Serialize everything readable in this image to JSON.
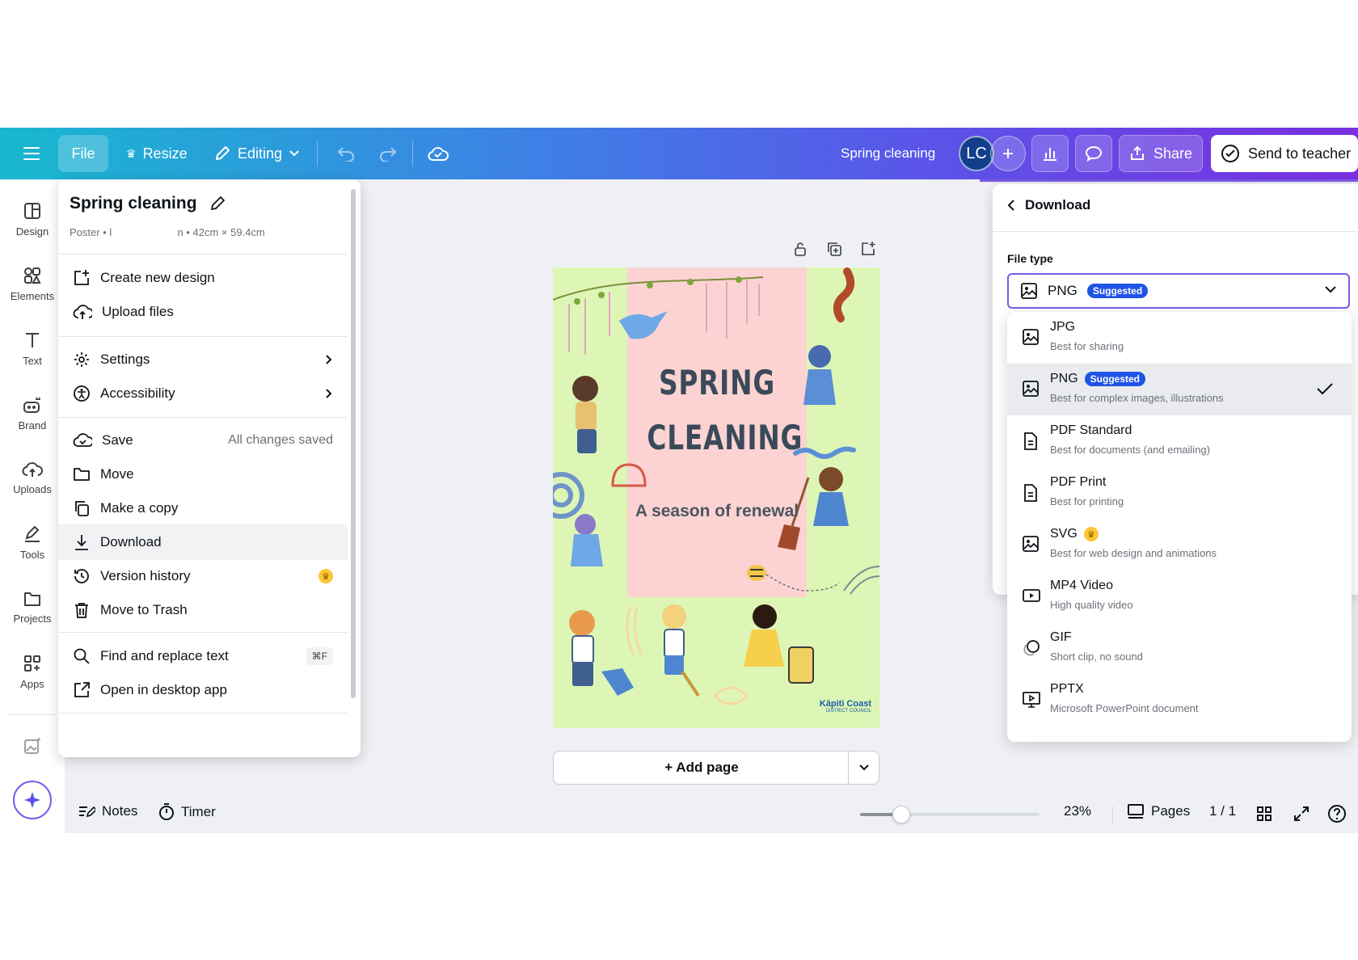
{
  "topbar": {
    "file_label": "File",
    "resize_label": "Resize",
    "editing_label": "Editing",
    "doc_title": "Spring cleaning",
    "avatar_initials": "LC",
    "share_label": "Share",
    "send_label": "Send to teacher"
  },
  "rail": {
    "items": [
      {
        "label": "Design",
        "icon": "layout-icon"
      },
      {
        "label": "Elements",
        "icon": "shapes-icon"
      },
      {
        "label": "Text",
        "icon": "text-icon"
      },
      {
        "label": "Brand",
        "icon": "brand-icon"
      },
      {
        "label": "Uploads",
        "icon": "cloud-upload-icon"
      },
      {
        "label": "Tools",
        "icon": "pen-icon"
      },
      {
        "label": "Projects",
        "icon": "folder-icon"
      },
      {
        "label": "Apps",
        "icon": "apps-icon"
      }
    ]
  },
  "file_menu": {
    "title": "Spring cleaning",
    "meta_left": "Poster • l",
    "meta_right": "n • 42cm × 59.4cm",
    "items": {
      "create": "Create new design",
      "upload": "Upload files",
      "settings": "Settings",
      "accessibility": "Accessibility",
      "save": "Save",
      "save_status": "All changes saved",
      "move": "Move",
      "copy": "Make a copy",
      "download": "Download",
      "version": "Version history",
      "trash": "Move to Trash",
      "find": "Find and replace text",
      "find_shortcut": "⌘F",
      "desktop": "Open in desktop app"
    }
  },
  "poster": {
    "title_line1": "SPRING",
    "title_line2": "CLEANING",
    "subtitle": "A season of renewal",
    "logo_line1": "Kāpiti Coast",
    "logo_line2": "DISTRICT COUNCIL"
  },
  "canvas": {
    "add_page_label": "+ Add page"
  },
  "bottombar": {
    "notes_label": "Notes",
    "timer_label": "Timer",
    "zoom_percent": 23,
    "zoom_label": "23%",
    "zoom_slider_fraction": 0.23,
    "pages_label": "Pages",
    "page_count": "1 / 1"
  },
  "download_panel": {
    "header": "Download",
    "file_type_label": "File type",
    "selected": "PNG",
    "suggested_badge": "Suggested",
    "options": [
      {
        "name": "JPG",
        "desc": "Best for sharing",
        "icon": "image-icon"
      },
      {
        "name": "PNG",
        "desc": "Best for complex images, illustrations",
        "icon": "image-icon",
        "badge": "Suggested",
        "selected": true
      },
      {
        "name": "PDF Standard",
        "desc": "Best for documents (and emailing)",
        "icon": "document-icon"
      },
      {
        "name": "PDF Print",
        "desc": "Best for printing",
        "icon": "document-icon"
      },
      {
        "name": "SVG",
        "desc": "Best for web design and animations",
        "icon": "image-icon",
        "premium": true
      },
      {
        "name": "MP4 Video",
        "desc": "High quality video",
        "icon": "video-icon"
      },
      {
        "name": "GIF",
        "desc": "Short clip, no sound",
        "icon": "gif-icon"
      },
      {
        "name": "PPTX",
        "desc": "Microsoft PowerPoint document",
        "icon": "presentation-icon"
      }
    ]
  },
  "colors": {
    "accent": "#7b5ce6",
    "badge": "#1f54e6",
    "poster_bg": "#ddf6b6",
    "poster_panel": "#fcd3d2"
  }
}
